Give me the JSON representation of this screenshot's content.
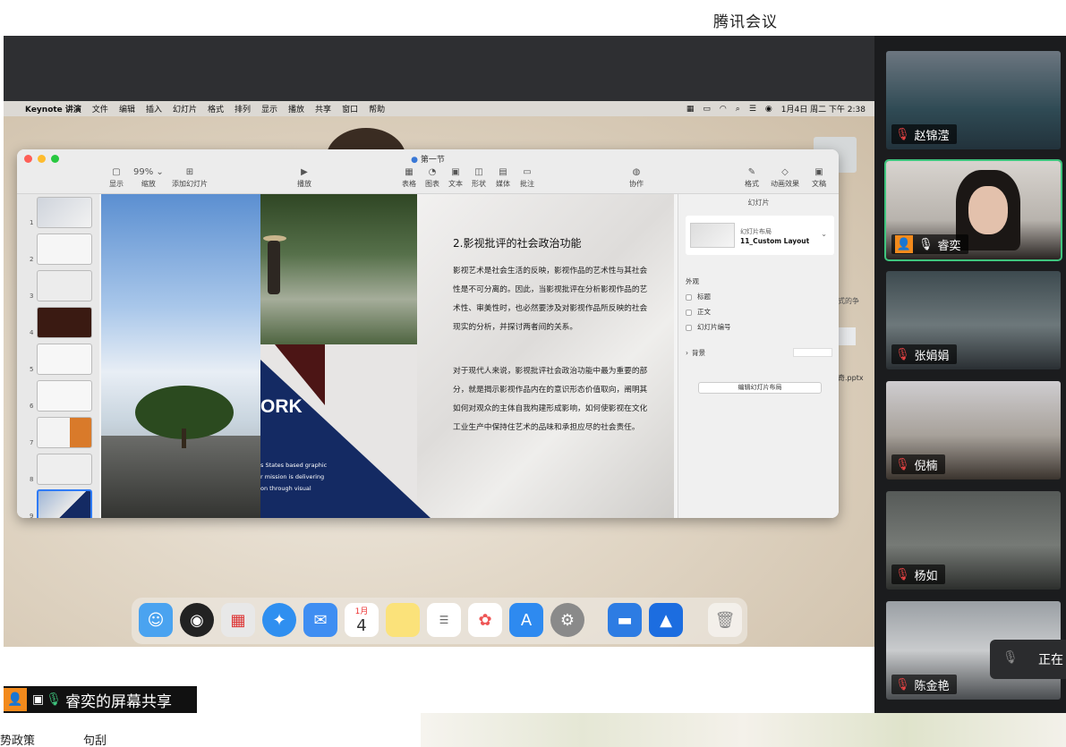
{
  "app": {
    "title": "腾讯会议"
  },
  "mac_menubar": {
    "apple": "",
    "items": [
      "Keynote 讲演",
      "文件",
      "编辑",
      "插入",
      "幻灯片",
      "格式",
      "排列",
      "显示",
      "播放",
      "共享",
      "窗口",
      "帮助"
    ],
    "clock": "1月4日 周二 下午 2:38"
  },
  "keynote": {
    "doc_title": "第一节",
    "zoom": "99%",
    "toolbar": {
      "display": "显示",
      "zoom_label": "缩放",
      "add_slide": "添加幻灯片",
      "play": "播放",
      "table": "表格",
      "chart": "图表",
      "text": "文本",
      "shape": "形状",
      "media": "媒体",
      "comment": "批注",
      "collaborate": "协作",
      "format": "格式",
      "animate": "动画效果",
      "document": "文稿"
    },
    "thumb_numbers": [
      "1",
      "2",
      "3",
      "4",
      "5",
      "6",
      "7",
      "8",
      "9"
    ],
    "slide": {
      "work_text": "ORK",
      "english_lines": [
        "s States based graphic",
        "r mission is delivering",
        "on through visual"
      ],
      "title": "2.影视批评的社会政治功能",
      "para1": "影视艺术是社会生活的反映，影视作品的艺术性与其社会性是不可分离的。因此，当影视批评在分析影视作品的艺术性、审美性时，也必然要涉及对影视作品所反映的社会现实的分析，并探讨两者间的关系。",
      "para2": "对于现代人来说，影视批评社会政治功能中最为重要的部分，就是揭示影视作品内在的意识形态价值取向，阐明其如何对观众的主体自我构建形成影响，如何使影视在文化工业生产中保持住艺术的品味和承担应尽的社会责任。"
    },
    "inspector": {
      "header": "幻灯片",
      "layout_label": "幻灯片布局",
      "layout_name": "11_Custom Layout",
      "appearance": "外观",
      "title_chk": "标题",
      "body_chk": "正文",
      "number_chk": "幻灯片编号",
      "background": "背景",
      "edit_layout": "编辑幻灯片布局"
    }
  },
  "desktop": {
    "file_label": "奇.pptx",
    "side_label": "式的争"
  },
  "dock": {
    "calendar_month": "1月",
    "calendar_day": "4"
  },
  "share": {
    "label": "睿奕的屏幕共享"
  },
  "bottom": {
    "left": "势政策",
    "mid": "句刮"
  },
  "participants": [
    {
      "name": "赵锦滢",
      "muted": true
    },
    {
      "name": "睿奕",
      "muted": false,
      "active": true
    },
    {
      "name": "张娟娟",
      "muted": true
    },
    {
      "name": "倪楠",
      "muted": true
    },
    {
      "name": "杨如",
      "muted": true
    },
    {
      "name": "陈金艳",
      "muted": true
    }
  ],
  "toast": {
    "text": "正在"
  },
  "colors": {
    "accent_green": "#3fc57e",
    "mute_red": "#e94343",
    "navy": "#142a63",
    "share_orange": "#f28a1c"
  }
}
